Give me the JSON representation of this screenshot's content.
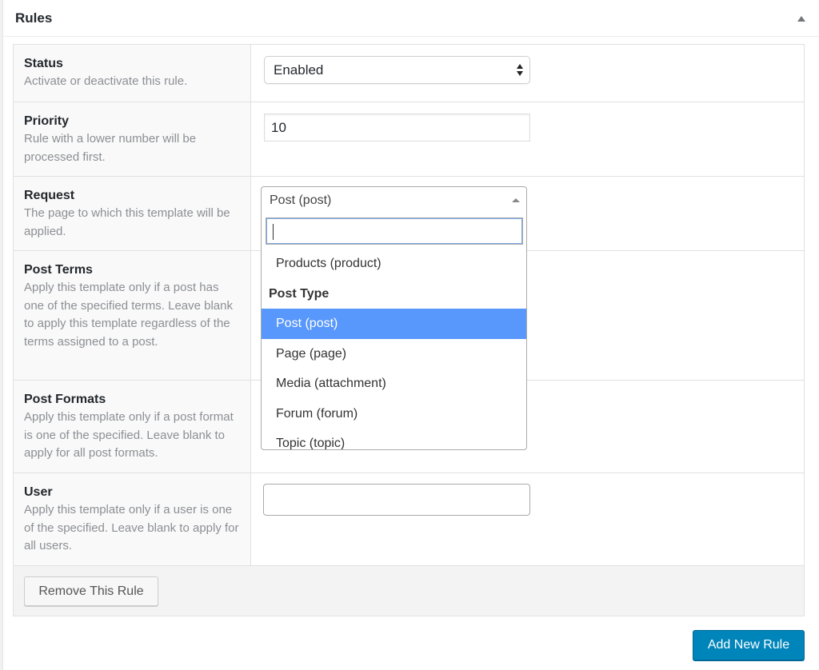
{
  "metabox": {
    "title": "Rules"
  },
  "rows": [
    {
      "label": "Status",
      "desc": "Activate or deactivate this rule.",
      "value": "Enabled"
    },
    {
      "label": "Priority",
      "desc": "Rule with a lower number will be processed first.",
      "value": "10"
    },
    {
      "label": "Request",
      "desc": "The page to which this template will be applied.",
      "value": "Post (post)"
    },
    {
      "label": "Post Terms",
      "desc": "Apply this template only if a post has one of the specified terms. Leave blank to apply this template regardless of the terms assigned to a post."
    },
    {
      "label": "Post Formats",
      "desc": "Apply this template only if a post format is one of the specified. Leave blank to apply for all post formats."
    },
    {
      "label": "User",
      "desc": "Apply this template only if a user is one of the specified. Leave blank to apply for all users.",
      "value": ""
    }
  ],
  "dropdown": {
    "search_value": "",
    "options": [
      {
        "label": "Products (product)",
        "type": "option"
      },
      {
        "label": "Post Type",
        "type": "group"
      },
      {
        "label": "Post (post)",
        "type": "option",
        "selected": true
      },
      {
        "label": "Page (page)",
        "type": "option"
      },
      {
        "label": "Media (attachment)",
        "type": "option"
      },
      {
        "label": "Forum (forum)",
        "type": "option"
      },
      {
        "label": "Topic (topic)",
        "type": "option"
      }
    ]
  },
  "buttons": {
    "remove_rule": "Remove This Rule",
    "add_rule": "Add New Rule"
  },
  "colors": {
    "primary": "#0085ba",
    "highlight": "#5897fb"
  }
}
